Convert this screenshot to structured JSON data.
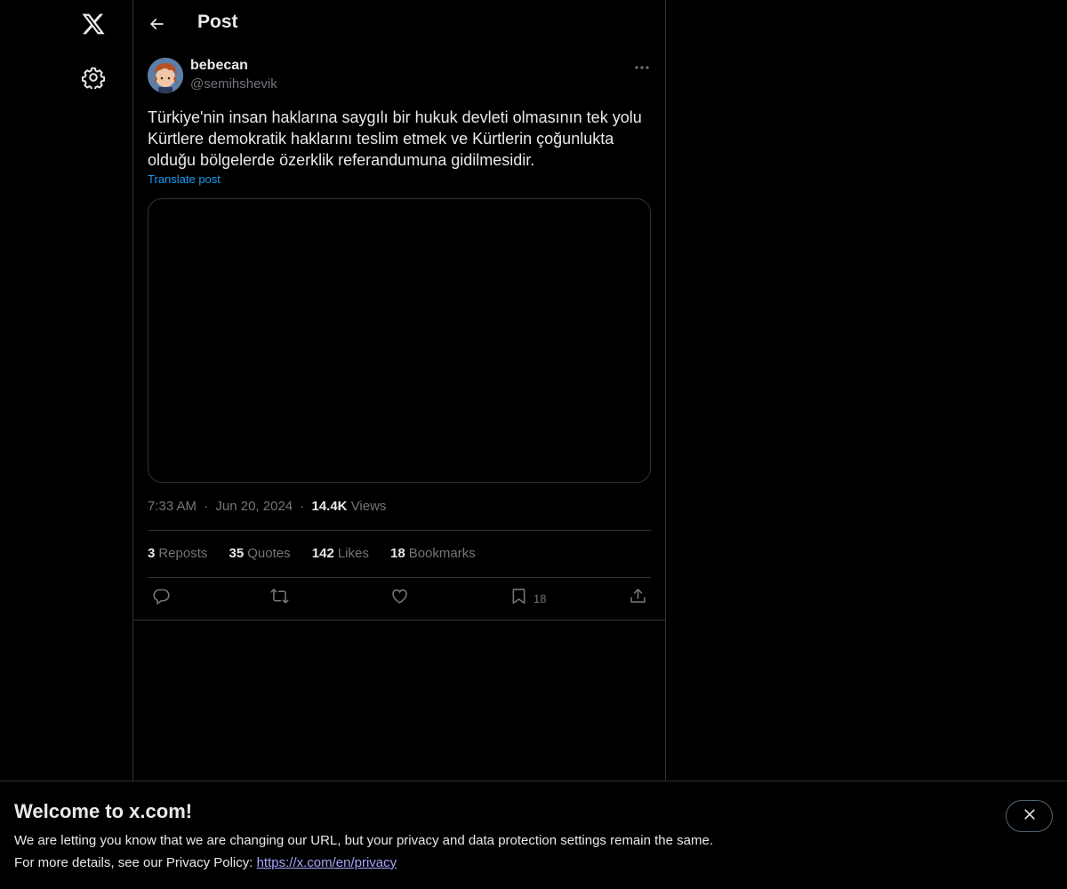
{
  "nav": {
    "logo_icon": "x-logo-icon",
    "settings_icon": "gear-icon"
  },
  "header": {
    "title": "Post",
    "back_icon": "arrow-left-icon"
  },
  "post": {
    "display_name": "bebecan",
    "handle": "@semihshevik",
    "text": "Türkiye'nin insan haklarına saygılı bir hukuk devleti olmasının tek yolu Kürtlere demokratik haklarını teslim etmek ve Kürtlerin çoğunlukta olduğu bölgelerde özerklik referandumuna gidilmesidir.",
    "translate_label": "Translate post",
    "time": "7:33 AM",
    "separator": "·",
    "date": "Jun 20, 2024",
    "views_count": "14.4K",
    "views_label": "Views"
  },
  "stats": {
    "reposts_count": "3",
    "reposts_label": "Reposts",
    "quotes_count": "35",
    "quotes_label": "Quotes",
    "likes_count": "142",
    "likes_label": "Likes",
    "bookmarks_count": "18",
    "bookmarks_label": "Bookmarks"
  },
  "actions": {
    "bookmark_count": "18"
  },
  "banner": {
    "title": "Welcome to x.com!",
    "line1": "We are letting you know that we are changing our URL, but your privacy and data protection settings remain the same.",
    "line2_prefix": "For more details, see our Privacy Policy: ",
    "link": "https://x.com/en/privacy"
  },
  "colors": {
    "background": "#000000",
    "text": "#e7e9ea",
    "muted": "#71767b",
    "accent": "#1d9bf0",
    "border": "#2f3336",
    "link": "#a6a4ff"
  }
}
